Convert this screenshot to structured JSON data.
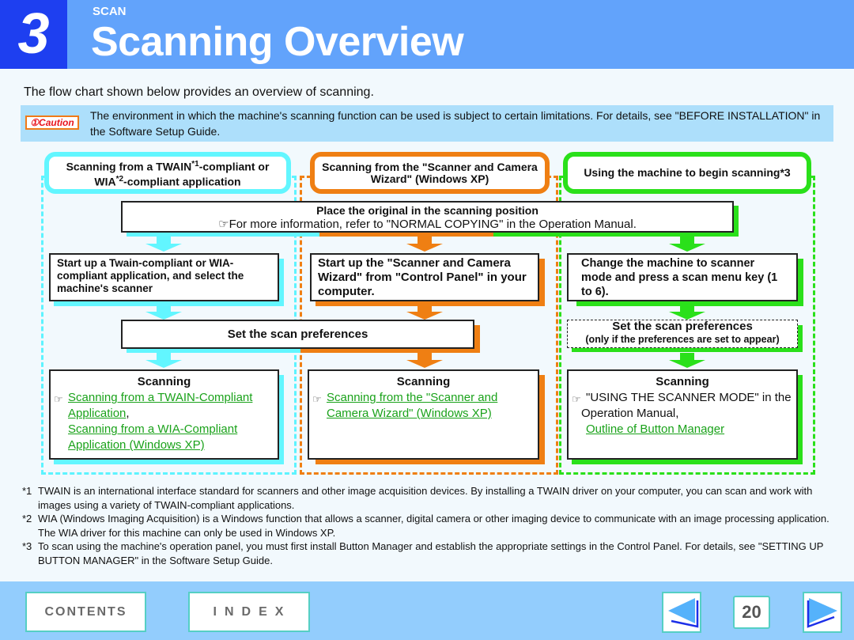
{
  "header": {
    "chapter_number": "3",
    "chapter_label": "SCAN",
    "title": "Scanning Overview"
  },
  "intro": "The flow chart shown below provides an overview of scanning.",
  "caution": {
    "badge_icon": "exclamation-circle-icon",
    "badge_label": "Caution",
    "text": "The environment in which the machine's scanning function can be used is subject to certain limitations. For details, see \"BEFORE INSTALLATION\" in the Software Setup Guide."
  },
  "colors": {
    "cyan": "#62f6ff",
    "orange": "#ef7f13",
    "green": "#2ae01a",
    "link": "#1aa21a",
    "header_blue": "#62a3fb",
    "chapter_blue": "#1e3ff0",
    "footer_blue": "#93cdfd"
  },
  "flow": {
    "columns": [
      {
        "header_pre": "Scanning from a TWAIN",
        "header_sup1": "*1",
        "header_mid": "-compliant or WIA",
        "header_sup2": "*2",
        "header_post": "-compliant application",
        "step": "Start up a Twain-compliant or WIA-compliant application, and select the machine's scanner",
        "scanning_title": "Scanning",
        "scanning_links": [
          "Scanning from a TWAIN-Compliant Application",
          "Scanning from a WIA-Compliant Application (Windows XP)"
        ],
        "link_separator": ","
      },
      {
        "header": "Scanning from the \"Scanner and Camera Wizard\" (Windows XP)",
        "step": "Start up the \"Scanner and Camera Wizard\" from \"Control Panel\" in your computer.",
        "scanning_title": "Scanning",
        "scanning_links": [
          "Scanning from the \"Scanner and Camera Wizard\" (Windows XP)"
        ]
      },
      {
        "header": "Using the machine to begin scanning*3",
        "step": "Change the machine to scanner mode and press a scan menu key (1 to 6).",
        "preferences_title": "Set the scan preferences",
        "preferences_note": "(only if the preferences are set to appear)",
        "scanning_title": "Scanning",
        "scanning_text": "\"USING THE SCANNER MODE\" in the Operation Manual,",
        "scanning_links": [
          "Outline of Button Manager"
        ]
      }
    ],
    "place": {
      "title": "Place the original in the scanning position",
      "detail": "For more information, refer to \"NORMAL COPYING\" in the Operation Manual."
    },
    "preferences_shared": "Set the scan preferences",
    "reference_icon": "☞"
  },
  "footnotes": [
    {
      "key": "*1",
      "text": "TWAIN is an international interface standard for scanners and other image acquisition devices. By installing a TWAIN driver on your computer, you can scan and work with images using a variety of TWAIN-compliant applications."
    },
    {
      "key": "*2",
      "text": "WIA (Windows Imaging Acquisition) is a Windows function that allows a scanner, digital camera or other imaging device to communicate with an image processing application. The WIA driver for this machine can only be used in Windows XP."
    },
    {
      "key": "*3",
      "text": "To scan using the machine's operation panel, you must first install Button Manager and establish the appropriate settings in the Control Panel. For details, see \"SETTING UP BUTTON MANAGER\" in the Software Setup Guide."
    }
  ],
  "footer": {
    "contents_label": "CONTENTS",
    "index_label": "INDEX",
    "page_number": "20",
    "prev_icon": "triangle-left-icon",
    "next_icon": "triangle-right-icon"
  }
}
